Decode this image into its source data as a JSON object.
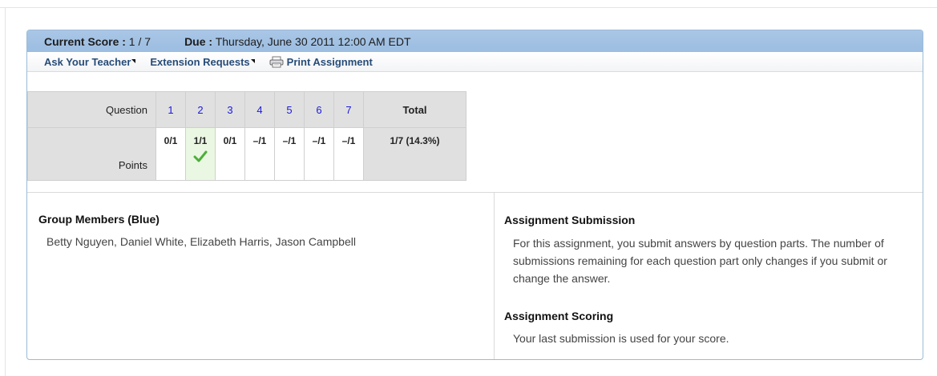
{
  "header": {
    "current_score_label": "Current Score :",
    "current_score_value": " 1 / 7",
    "due_label": "Due :",
    "due_value": " Thursday, June 30 2011 12:00 AM EDT"
  },
  "links": {
    "ask_teacher": "Ask Your Teacher",
    "extension_requests": "Extension Requests",
    "print_assignment": "Print Assignment"
  },
  "score_table": {
    "question_label": "Question",
    "points_label": "Points",
    "total_label": "Total",
    "questions": [
      "1",
      "2",
      "3",
      "4",
      "5",
      "6",
      "7"
    ],
    "points": [
      "0/1",
      "1/1",
      "0/1",
      "–/1",
      "–/1",
      "–/1",
      "–/1"
    ],
    "total_value": "1/7 (14.3%)"
  },
  "group": {
    "title": "Group Members (Blue)",
    "members": "Betty Nguyen, Daniel White, Elizabeth Harris, Jason Campbell"
  },
  "submission": {
    "title": "Assignment Submission",
    "text": "For this assignment, you submit answers by question parts. The number of submissions remaining for each question part only changes if you submit or change the answer."
  },
  "scoring": {
    "title": "Assignment Scoring",
    "text": "Your last submission is used for your score."
  },
  "colors": {
    "header_bar": "#a9c6e6",
    "link": "#274c78",
    "question_link": "#1a1adb",
    "correct_bg": "#eaf7e2",
    "check": "#4caf3a"
  },
  "icons": {
    "print": "printer-icon",
    "correct": "checkmark-icon"
  }
}
